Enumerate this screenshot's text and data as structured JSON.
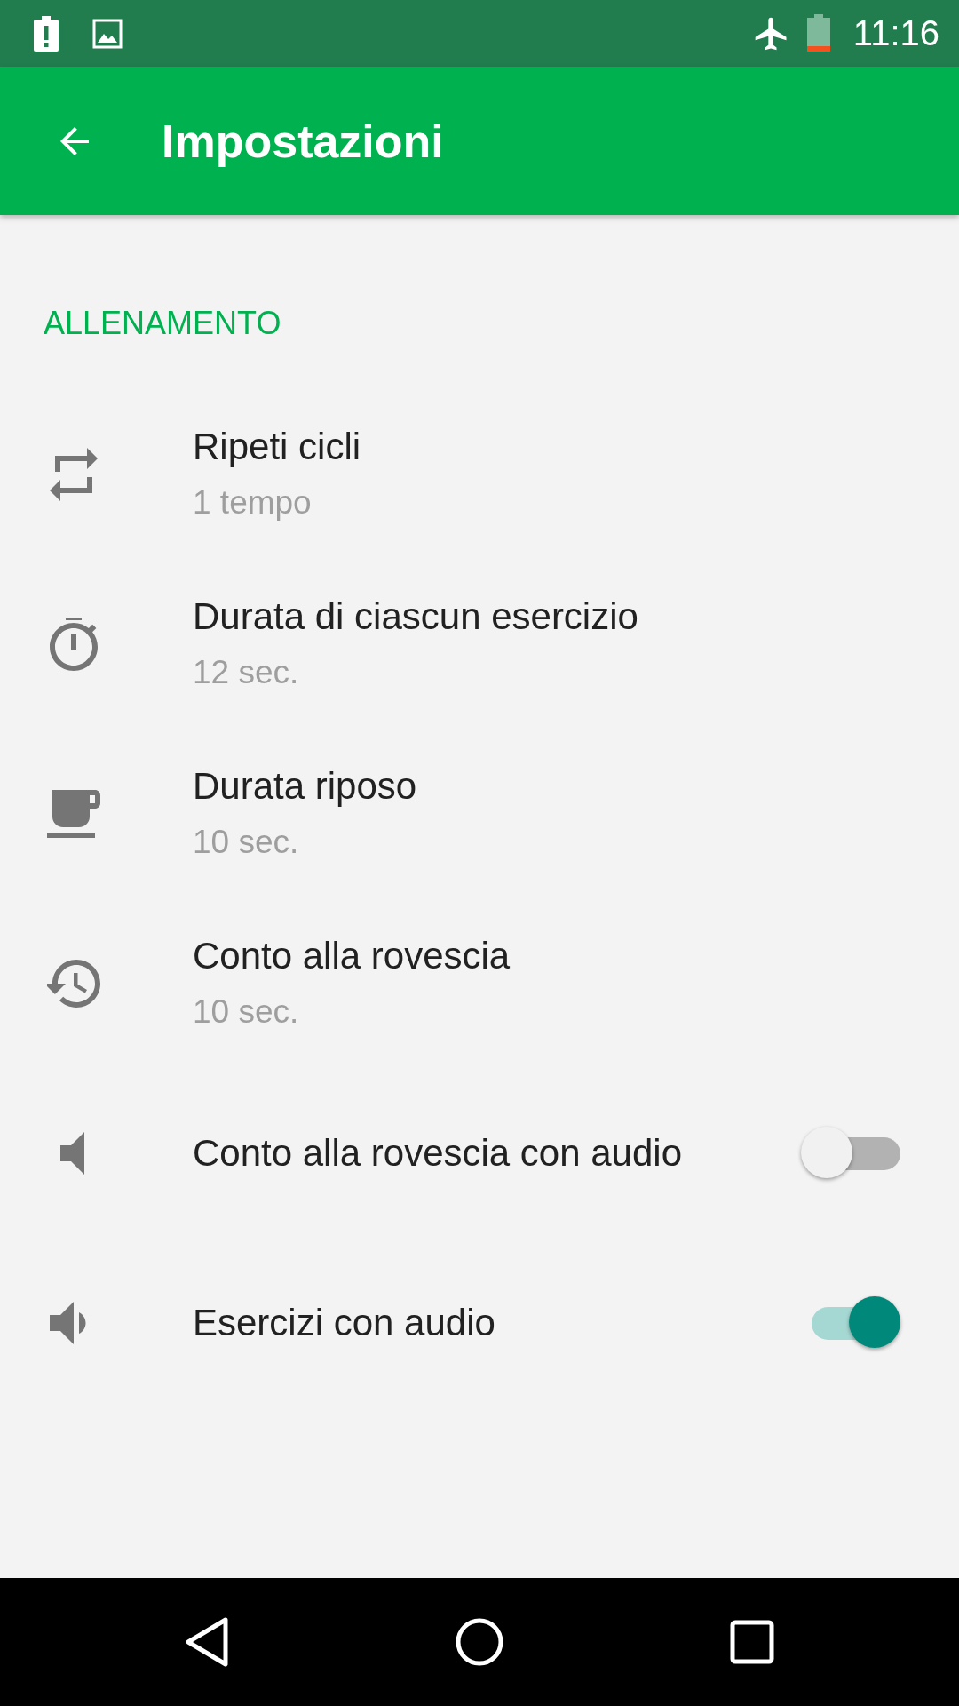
{
  "status_bar": {
    "time": "11:16"
  },
  "app_bar": {
    "title": "Impostazioni"
  },
  "section": {
    "header": "ALLENAMENTO"
  },
  "items": [
    {
      "kind": "value",
      "title": "Ripeti cicli",
      "summary": "1 tempo"
    },
    {
      "kind": "value",
      "title": "Durata di ciascun esercizio",
      "summary": "12 sec."
    },
    {
      "kind": "value",
      "title": "Durata riposo",
      "summary": "10 sec."
    },
    {
      "kind": "value",
      "title": "Conto alla rovescia",
      "summary": "10 sec."
    },
    {
      "kind": "switch",
      "title": "Conto alla rovescia con audio",
      "on": false
    },
    {
      "kind": "switch",
      "title": "Esercizi con audio",
      "on": true
    }
  ]
}
